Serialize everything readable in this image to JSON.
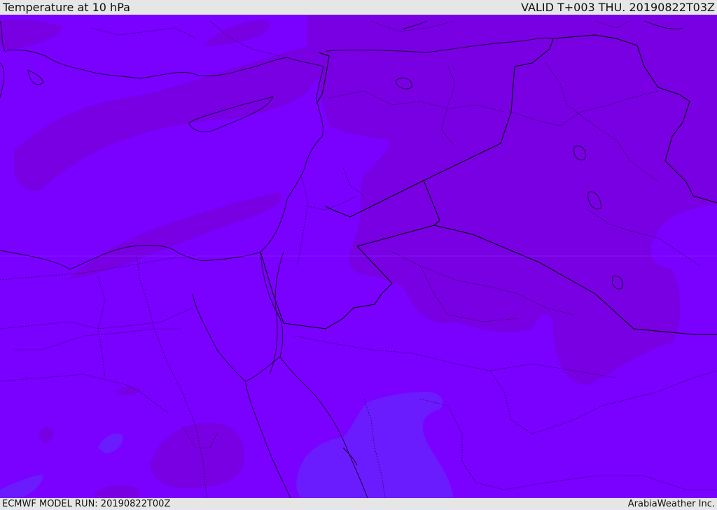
{
  "header": {
    "title": "Temperature at 10 hPa",
    "valid": "VALID T+003 THU. 20190822T03Z"
  },
  "footer": {
    "model_run": "ECMWF MODEL RUN: 20190822T00Z",
    "credit": "ArabiaWeather Inc."
  },
  "colors": {
    "base": "#7a00ff",
    "warm": "#7800e3",
    "cool": "#6a1cff",
    "coast": "#1a0033",
    "border": "#000000",
    "bar_bg": "#e6e6e6"
  }
}
